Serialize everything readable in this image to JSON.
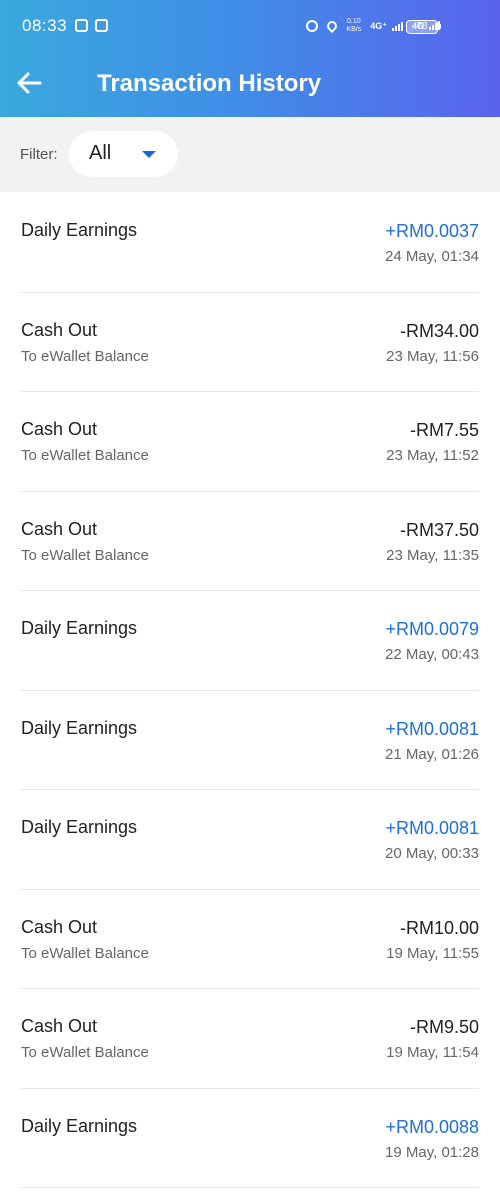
{
  "status": {
    "time": "08:33",
    "net_speed_value": "0.10",
    "net_speed_unit": "KB/s",
    "net1": "4G⁺",
    "net2": "4G",
    "battery": "78"
  },
  "header": {
    "title": "Transaction History"
  },
  "filter": {
    "label": "Filter:",
    "value": "All"
  },
  "colors": {
    "positive": "#1e6fdc",
    "negative": "#222222",
    "accent": "#1a66d9"
  },
  "transactions": [
    {
      "title": "Daily Earnings",
      "subtitle": "",
      "amount": "+RM0.0037",
      "time": "24 May, 01:34",
      "positive": true
    },
    {
      "title": "Cash Out",
      "subtitle": "To eWallet Balance",
      "amount": "-RM34.00",
      "time": "23 May, 11:56",
      "positive": false
    },
    {
      "title": "Cash Out",
      "subtitle": "To eWallet Balance",
      "amount": "-RM7.55",
      "time": "23 May, 11:52",
      "positive": false
    },
    {
      "title": "Cash Out",
      "subtitle": "To eWallet Balance",
      "amount": "-RM37.50",
      "time": "23 May, 11:35",
      "positive": false
    },
    {
      "title": "Daily Earnings",
      "subtitle": "",
      "amount": "+RM0.0079",
      "time": "22 May, 00:43",
      "positive": true
    },
    {
      "title": "Daily Earnings",
      "subtitle": "",
      "amount": "+RM0.0081",
      "time": "21 May, 01:26",
      "positive": true
    },
    {
      "title": "Daily Earnings",
      "subtitle": "",
      "amount": "+RM0.0081",
      "time": "20 May, 00:33",
      "positive": true
    },
    {
      "title": "Cash Out",
      "subtitle": "To eWallet Balance",
      "amount": "-RM10.00",
      "time": "19 May, 11:55",
      "positive": false
    },
    {
      "title": "Cash Out",
      "subtitle": "To eWallet Balance",
      "amount": "-RM9.50",
      "time": "19 May, 11:54",
      "positive": false
    },
    {
      "title": "Daily Earnings",
      "subtitle": "",
      "amount": "+RM0.0088",
      "time": "19 May, 01:28",
      "positive": true
    }
  ]
}
